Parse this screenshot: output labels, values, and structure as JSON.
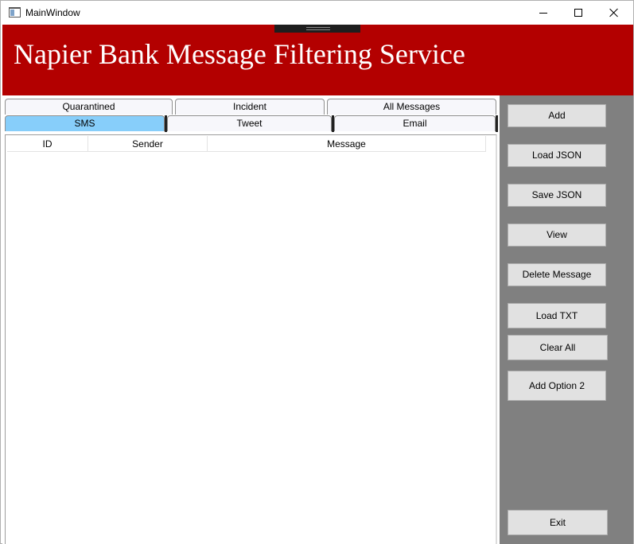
{
  "window": {
    "title": "MainWindow"
  },
  "banner": {
    "title": "Napier Bank Message Filtering Service",
    "color": "#b30000"
  },
  "tabs": {
    "row1": [
      {
        "label": "Quarantined"
      },
      {
        "label": "Incident"
      },
      {
        "label": "All Messages"
      }
    ],
    "row2": [
      {
        "label": "SMS",
        "selected": true
      },
      {
        "label": "Tweet",
        "selected": false
      },
      {
        "label": "Email",
        "selected": false
      }
    ],
    "selected_color": "#87cefa"
  },
  "table": {
    "columns": [
      "ID",
      "Sender",
      "Message"
    ],
    "rows": []
  },
  "actions": {
    "add": "Add",
    "load_json": "Load JSON",
    "save_json": "Save JSON",
    "view": "View",
    "delete_message": "Delete Message",
    "load_txt": "Load TXT",
    "clear_all": "Clear All",
    "add_option_2": "Add Option 2",
    "exit": "Exit"
  },
  "panel_color": "#808080"
}
